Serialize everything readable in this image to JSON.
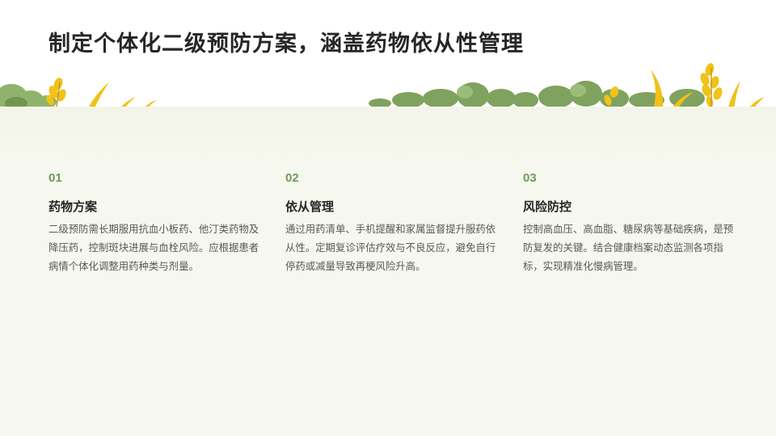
{
  "slide": {
    "title": "制定个体化二级预防方案，涵盖药物依从性管理"
  },
  "columns": [
    {
      "number": "01",
      "heading": "药物方案",
      "text": "二级预防需长期服用抗血小板药、他汀类药物及降压药，控制斑块进展与血栓风险。应根据患者病情个体化调整用药种类与剂量。"
    },
    {
      "number": "02",
      "heading": "依从管理",
      "text": "通过用药清单、手机提醒和家属监督提升服药依从性。定期复诊评估疗效与不良反应，避免自行停药或减量导致再梗风险升高。"
    },
    {
      "number": "03",
      "heading": "风险防控",
      "text": "控制高血压、高血脂、糖尿病等基础疾病，是预防复发的关键。结合健康档案动态监测各项指标，实现精准化慢病管理。"
    }
  ],
  "colors": {
    "accent_green": "#6f9a58",
    "background": "#f6f7ee",
    "title_text": "#262626",
    "body_text": "#595959",
    "grain_yellow": "#f0c21a",
    "foliage_green": "#7fa25e"
  },
  "decorations": [
    "wheat-grass-illustration-left",
    "wheat-grass-illustration-right",
    "bush-illustration"
  ]
}
